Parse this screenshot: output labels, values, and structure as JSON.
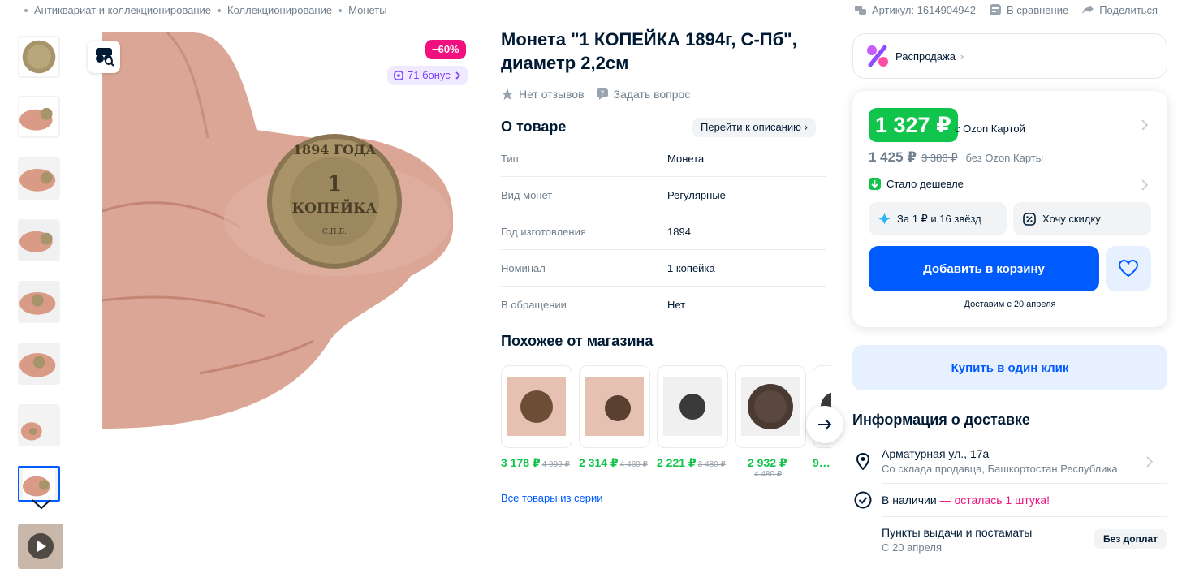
{
  "breadcrumbs": [
    "Антиквариат и коллекционирование",
    "Коллекционирование",
    "Монеты"
  ],
  "top_actions": {
    "article": "Артикул: 1614904942",
    "compare": "В сравнение",
    "share": "Поделиться"
  },
  "gallery": {
    "discount_badge": "−60%",
    "bonus_badge": "71 бонус",
    "coin_text_year": "1894 ГОДА",
    "coin_text_value": "1",
    "coin_text_kop": "КОПЕЙКА",
    "coin_text_mint": "С.П.Б."
  },
  "product": {
    "title": "Монета \"1 КОПЕЙКА 1894г, С-Пб\", диаметр 2,2см",
    "reviews": "Нет отзывов",
    "ask": "Задать вопрос"
  },
  "about": {
    "heading": "О товаре",
    "goto_label": "Перейти к описанию",
    "specs": [
      {
        "k": "Тип",
        "v": "Монета"
      },
      {
        "k": "Вид монет",
        "v": "Регулярные"
      },
      {
        "k": "Год изготовления",
        "v": "1894"
      },
      {
        "k": "Номинал",
        "v": "1 копейка"
      },
      {
        "k": "В обращении",
        "v": "Нет"
      }
    ]
  },
  "similar": {
    "heading": "Похожее от магазина",
    "items": [
      {
        "price": "3 178 ₽",
        "old": "4 999 ₽"
      },
      {
        "price": "2 314 ₽",
        "old": "4 460 ₽"
      },
      {
        "price": "2 221 ₽",
        "old": "3 480 ₽"
      },
      {
        "price": "2 932 ₽",
        "old": "4 480 ₽"
      },
      {
        "price": "9…",
        "old": ""
      }
    ],
    "all_series": "Все товары из серии"
  },
  "buybox": {
    "sale_label": "Распродажа",
    "price_card": "1 327 ₽",
    "price_card_label": "с Ozon Картой",
    "price_regular": "1 425 ₽",
    "price_old": "3 380 ₽",
    "price_regular_label": "без Ozon Карты",
    "cheaper": "Стало дешевле",
    "stars_offer": "За 1 ₽ и 16 звёзд",
    "want_discount": "Хочу скидку",
    "add_to_cart": "Добавить в корзину",
    "delivery_date": "Доставим с 20 апреля",
    "one_click": "Купить в один клик"
  },
  "delivery_info": {
    "heading": "Информация о доставке",
    "address": "Арматурная ул., 17а",
    "address_sub": "Со склада продавца, Башкортостан Республика",
    "stock_a": "В наличии",
    "stock_b": "— осталась 1 штука!",
    "pickup": "Пункты выдачи и постаматы",
    "pickup_sub": "С 20 апреля",
    "pickup_badge": "Без доплат"
  },
  "colors": {
    "accent": "#005bff",
    "green": "#10c44c",
    "pink": "#f1117e"
  }
}
